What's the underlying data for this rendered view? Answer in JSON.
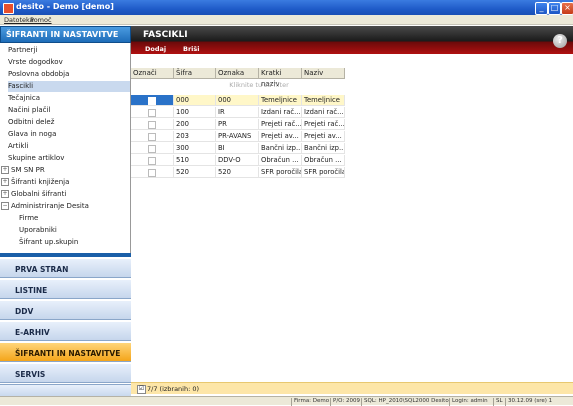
{
  "window": {
    "title": "desito - Demo [demo]"
  },
  "menu": [
    "Datoteka",
    "Pomoč"
  ],
  "left_panel": {
    "title": "ŠIFRANTI IN NASTAVITVE",
    "tree": [
      {
        "label": "Partnerji",
        "indent": 1,
        "expander": ""
      },
      {
        "label": "Vrste dogodkov",
        "indent": 1,
        "expander": ""
      },
      {
        "label": "Poslovna obdobja",
        "indent": 1,
        "expander": ""
      },
      {
        "label": "Fascikli",
        "indent": 1,
        "expander": "",
        "selected": true
      },
      {
        "label": "Tečajnica",
        "indent": 1,
        "expander": ""
      },
      {
        "label": "Načini plačil",
        "indent": 1,
        "expander": ""
      },
      {
        "label": "Odbitni delež",
        "indent": 1,
        "expander": ""
      },
      {
        "label": "Glava in noga",
        "indent": 1,
        "expander": ""
      },
      {
        "label": "Artikli",
        "indent": 1,
        "expander": ""
      },
      {
        "label": "Skupine artiklov",
        "indent": 1,
        "expander": ""
      },
      {
        "label": "SM SN PR",
        "indent": 0,
        "expander": "+"
      },
      {
        "label": "Šifranti knjiženja",
        "indent": 0,
        "expander": "+"
      },
      {
        "label": "Globalni šifranti",
        "indent": 0,
        "expander": "+"
      },
      {
        "label": "Administriranje Desita",
        "indent": 0,
        "expander": "−"
      },
      {
        "label": "Firme",
        "indent": 2,
        "expander": ""
      },
      {
        "label": "Uporabniki",
        "indent": 2,
        "expander": ""
      },
      {
        "label": "Šifrant up.skupin",
        "indent": 2,
        "expander": ""
      }
    ],
    "nav": [
      {
        "label": "PRVA STRAN",
        "active": false
      },
      {
        "label": "LISTINE",
        "active": false
      },
      {
        "label": "DDV",
        "active": false
      },
      {
        "label": "E-ARHIV",
        "active": false
      },
      {
        "label": "ŠIFRANTI IN NASTAVITVE",
        "active": true
      },
      {
        "label": "SERVIS",
        "active": false
      }
    ]
  },
  "main": {
    "title": "FASCIKLI",
    "actions": [
      "Dodaj",
      "Briši"
    ],
    "help_label": "?",
    "columns": [
      "Označi",
      "Šifra",
      "Oznaka",
      "Kratki naziv",
      "Naziv"
    ],
    "filter_hint": "Kliknite tu za filter",
    "rows": [
      {
        "sifra": "000",
        "oznaka": "000",
        "kratki": "Temeljnice",
        "naziv": "Temeljnice",
        "selected": true
      },
      {
        "sifra": "100",
        "oznaka": "IR",
        "kratki": "Izdani rač...",
        "naziv": "Izdani rač...",
        "selected": false
      },
      {
        "sifra": "200",
        "oznaka": "PR",
        "kratki": "Prejeti rač...",
        "naziv": "Prejeti rač...",
        "selected": false
      },
      {
        "sifra": "203",
        "oznaka": "PR-AVANS",
        "kratki": "Prejeti av...",
        "naziv": "Prejeti av...",
        "selected": false
      },
      {
        "sifra": "300",
        "oznaka": "BI",
        "kratki": "Bančni izp...",
        "naziv": "Bančni izp...",
        "selected": false
      },
      {
        "sifra": "510",
        "oznaka": "DDV-O",
        "kratki": "Obračun ...",
        "naziv": "Obračun ...",
        "selected": false
      },
      {
        "sifra": "520",
        "oznaka": "520",
        "kratki": "SFR poročila",
        "naziv": "SFR poročila",
        "selected": false
      }
    ],
    "selection_status": "7/7 (izbranih: 0)",
    "selection_checkbox": "☑"
  },
  "statusbar": [
    "Firma: Demo",
    "P/O: 2009",
    "SQL: HP_2010\\SQL2000 Desito",
    "Login: admin",
    "SL",
    "30.12.09 (sre) 1"
  ],
  "colors": {
    "accent_active": "#f4a51a",
    "header_red": "#b01010",
    "nav_blue": "#1d6cb8"
  }
}
